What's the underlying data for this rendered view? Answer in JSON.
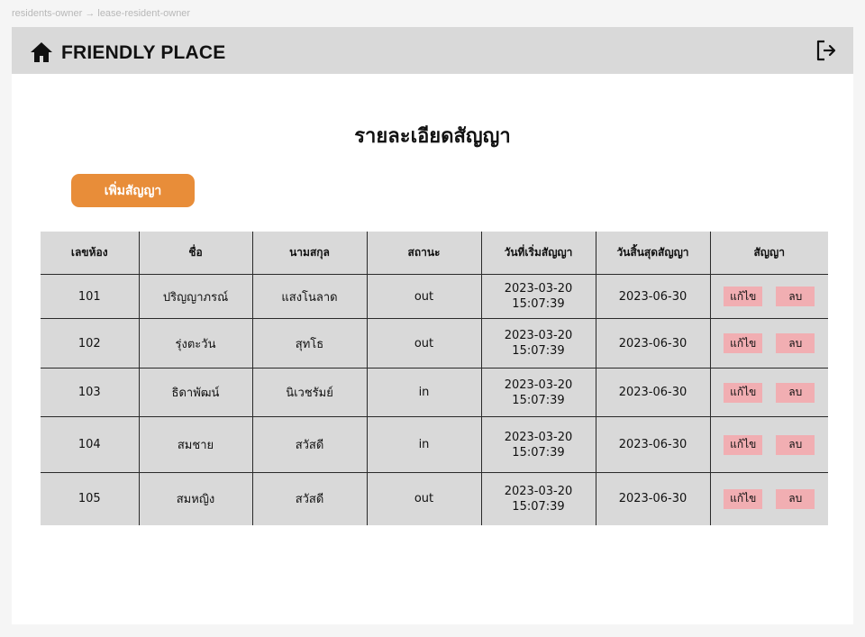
{
  "breadcrumb": "residents-owner → lease-resident-owner",
  "header": {
    "brand": "FRIENDLY PLACE"
  },
  "page": {
    "title": "รายละเอียดสัญญา",
    "add_button": "เพิ่มสัญญา"
  },
  "table": {
    "columns": [
      "เลขห้อง",
      "ชื่อ",
      "นามสกุล",
      "สถานะ",
      "วันที่เริ่มสัญญา",
      "วันสิ้นสุดสัญญา",
      "สัญญา"
    ],
    "edit_label": "แก้ไข",
    "delete_label": "ลบ",
    "rows": [
      {
        "room": "101",
        "first_name": "ปริญญาภรณ์",
        "last_name": "แสงโนลาด",
        "status": "out",
        "start_date": "2023-03-20",
        "start_time": "15:07:39",
        "end_date": "2023-06-30"
      },
      {
        "room": "102",
        "first_name": "รุ่งตะวัน",
        "last_name": "สุทโธ",
        "status": "out",
        "start_date": "2023-03-20",
        "start_time": "15:07:39",
        "end_date": "2023-06-30"
      },
      {
        "room": "103",
        "first_name": "ธิดาพัฒน์",
        "last_name": "นิเวชรัมย์",
        "status": "in",
        "start_date": "2023-03-20",
        "start_time": "15:07:39",
        "end_date": "2023-06-30"
      },
      {
        "room": "104",
        "first_name": "สมชาย",
        "last_name": "สวัสดี",
        "status": "in",
        "start_date": "2023-03-20",
        "start_time": "15:07:39",
        "end_date": "2023-06-30"
      },
      {
        "room": "105",
        "first_name": "สมหญิง",
        "last_name": "สวัสดี",
        "status": "out",
        "start_date": "2023-03-20",
        "start_time": "15:07:39",
        "end_date": "2023-06-30"
      }
    ]
  },
  "icons": {
    "home": "home-icon",
    "logout": "logout-icon"
  },
  "colors": {
    "accent": "#e88d39",
    "action_button": "#f1aeb2",
    "header_bg": "#d9d9d9",
    "table_bg": "#d9d9d9"
  }
}
